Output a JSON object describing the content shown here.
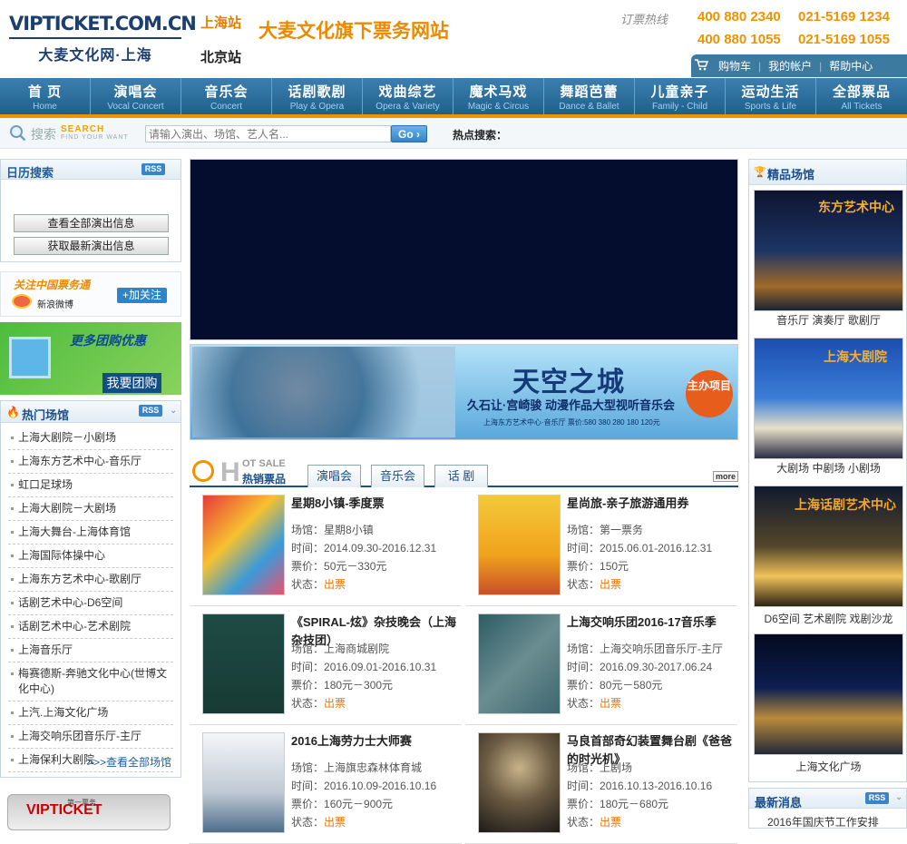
{
  "header": {
    "logo_domain": "VIPTICKET.COM.CN",
    "logo_sub": "大麦文化网·上海",
    "city_shanghai": "上海站",
    "city_beijing": "北京站",
    "slogan": "大麦文化旗下票务网站",
    "hotline_label": "订票热线",
    "phones": [
      "400 880 2340",
      "021-5169 1234",
      "400 880 1055",
      "021-5169 1055"
    ],
    "minibar": {
      "cart": "购物车",
      "account": "我的帐户",
      "help": "帮助中心"
    }
  },
  "nav": [
    {
      "zh": "首 页",
      "en": "Home"
    },
    {
      "zh": "演唱会",
      "en": "Vocal Concert"
    },
    {
      "zh": "音乐会",
      "en": "Concert"
    },
    {
      "zh": "话剧歌剧",
      "en": "Play & Opera"
    },
    {
      "zh": "戏曲综艺",
      "en": "Opera & Variety"
    },
    {
      "zh": "魔术马戏",
      "en": "Magic & Circus"
    },
    {
      "zh": "舞蹈芭蕾",
      "en": "Dance & Ballet"
    },
    {
      "zh": "儿童亲子",
      "en": "Family - Child"
    },
    {
      "zh": "运动生活",
      "en": "Sports & Life"
    },
    {
      "zh": "全部票品",
      "en": "All Tickets"
    }
  ],
  "search": {
    "label": "搜索",
    "label_en": "SEARCH",
    "label_en_sub": "FIND YOUR WANT",
    "placeholder": "请输入演出、场馆、艺人名...",
    "go": "Go",
    "hot_label": "热点搜索："
  },
  "left": {
    "calendar_title": "日历搜索",
    "rss": "RSS",
    "calendar_btn_all": "查看全部演出信息",
    "calendar_btn_new": "获取最新演出信息",
    "weibo_title": "关注中国票务通",
    "weibo_brand": "新浪微博",
    "weibo_url": "t.sina.com.cn",
    "weibo_follow": "+加关注",
    "group_text": "更多团购优惠",
    "group_btn": "我要团购",
    "venues_title": "热门场馆",
    "venues": [
      "上海大剧院－小剧场",
      "上海东方艺术中心-音乐厅",
      "虹口足球场",
      "上海大剧院－大剧场",
      "上海大舞台-上海体育馆",
      "上海国际体操中心",
      "上海东方艺术中心-歌剧厅",
      "话剧艺术中心-D6空间",
      "话剧艺术中心-艺术剧院",
      "上海音乐厅",
      "梅赛德斯-奔驰文化中心(世博文化中心)",
      "上汽.上海文化广场",
      "上海交响乐团音乐厅-主厅",
      "上海保利大剧院"
    ],
    "venues_more": ">>>查看全部场馆",
    "vip_card_text": "VIPTICKET",
    "vip_card_sub": "第一票务"
  },
  "main": {
    "banner_title": "天空之城",
    "banner_subtitle": "久石让·宫崎骏 动漫作品大型视听音乐会",
    "banner_venue": "上海东方艺术中心·音乐厅 票价:580 380 280 180 120元",
    "banner_badge": "主办项目",
    "hot_H": "H",
    "hot_en": "OT SALE",
    "hot_zh": "热销票品",
    "tabs": [
      "演唱会",
      "音乐会",
      "话 剧"
    ],
    "more": "more",
    "field_venue": "场馆：",
    "field_time": "时间：",
    "field_price": "票价：",
    "field_status": "状态：",
    "tickets": [
      {
        "name": "星期8小镇-季度票",
        "venue": "星期8小镇",
        "time": "2014.09.30-2016.12.31",
        "price": "50元－330元",
        "status": "出票"
      },
      {
        "name": "星尚旅-亲子旅游通用券",
        "venue": "第一票务",
        "time": "2015.06.01-2016.12.31",
        "price": "150元",
        "status": "出票"
      },
      {
        "name": "《SPIRAL-炫》杂技晚会（上海杂技团）",
        "venue": "上海商城剧院",
        "time": "2016.09.01-2016.10.31",
        "price": "180元－300元",
        "status": "出票"
      },
      {
        "name": "上海交响乐团2016-17音乐季",
        "venue": "上海交响乐团音乐厅-主厅",
        "time": "2016.09.30-2017.06.24",
        "price": "80元－580元",
        "status": "出票"
      },
      {
        "name": "2016上海劳力士大师赛",
        "venue": "上海旗忠森林体育城",
        "time": "2016.10.09-2016.10.16",
        "price": "160元－900元",
        "status": "出票"
      },
      {
        "name": "马良首部奇幻装置舞台剧《爸爸的时光机》",
        "venue": "上剧场",
        "time": "2016.10.13-2016.10.16",
        "price": "180元－680元",
        "status": "出票"
      }
    ]
  },
  "right": {
    "premium_title": "精品场馆",
    "venues": [
      {
        "name": "东方艺术中心",
        "caption": "音乐厅  演奏厅  歌剧厅"
      },
      {
        "name": "上海大剧院",
        "caption": "大剧场  中剧场  小剧场"
      },
      {
        "name": "上海话剧艺术中心",
        "caption": "D6空间  艺术剧院  戏剧沙龙"
      },
      {
        "name": "",
        "caption": "上海文化广场"
      }
    ],
    "news_title": "最新消息",
    "news_first": "2016年国庆节工作安排"
  },
  "colors": {
    "brand_blue": "#1c4f8a",
    "accent_orange": "#f29200",
    "nav_blue": "#2c6f9e"
  }
}
